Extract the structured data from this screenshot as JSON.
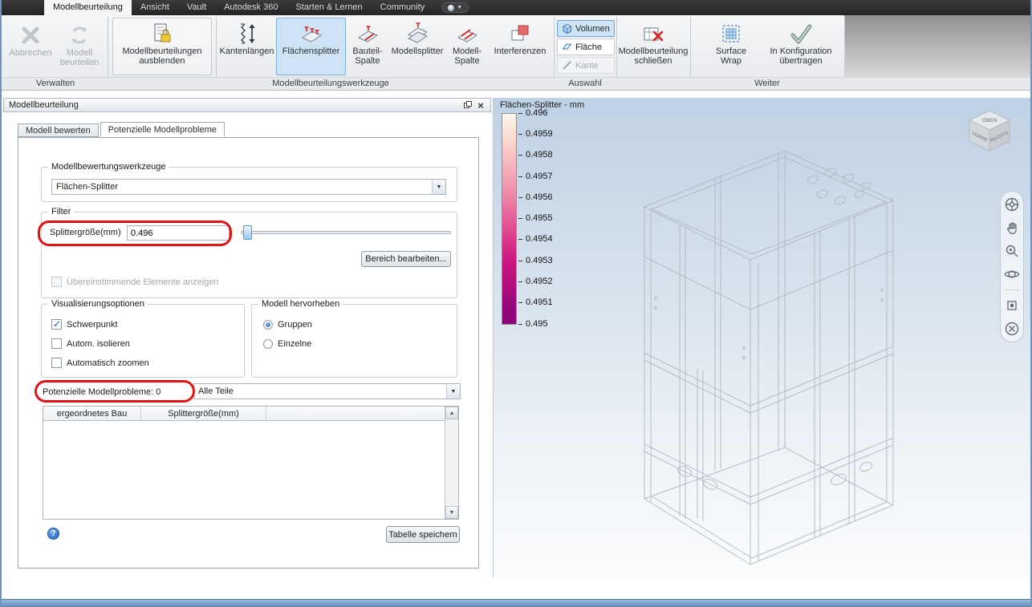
{
  "menubar": {
    "tabs": [
      "Modellbeurteilung",
      "Ansicht",
      "Vault",
      "Autodesk 360",
      "Starten & Lernen",
      "Community"
    ]
  },
  "ribbon": {
    "group_labels": {
      "verwalten": "Verwalten",
      "werkzeuge": "Modellbeurteilungswerkzeuge",
      "auswahl": "Auswahl",
      "weiter": "Weiter"
    },
    "buttons": {
      "abbrechen": "Abbrechen",
      "modell_beurteilen": "Modell beurteilen",
      "ausblenden": "Modellbeurteilungen ausblenden",
      "kantenlaengen": "Kantenlängen",
      "flaechensplitter": "Flächensplitter",
      "bauteil_spalte": "Bauteil-Spalte",
      "modellsplitter": "Modellsplitter",
      "modell_spalte": "Modell-Spalte",
      "interferenzen": "Interferenzen",
      "volumen": "Volumen",
      "flaeche": "Fläche",
      "kante": "Kante",
      "schliessen": "Modellbeurteilung schließen",
      "surface_wrap": "Surface Wrap",
      "konfiguration": "In Konfiguration übertragen"
    }
  },
  "panel": {
    "title": "Modellbeurteilung",
    "tabs": [
      "Modell bewerten",
      "Potenzielle Modellprobleme"
    ],
    "group_labels": {
      "werkzeuge": "Modellbewertungswerkzeuge",
      "filter": "Filter",
      "visualisierung": "Visualisierungsoptionen",
      "hervorheben": "Modell hervorheben"
    },
    "werkzeuge_selected": "Flächen-Splitter",
    "splitter_label": "Splittergröße(mm)",
    "splitter_value": "0.496",
    "bereich_button": "Bereich bearbeiten...",
    "uebereinstimmend_checkbox": "Übereinstimmende Elemente anzeigen",
    "checkboxes": [
      {
        "label": "Schwerpunkt",
        "checked": true
      },
      {
        "label": "Autom. isolieren",
        "checked": false
      },
      {
        "label": "Automatisch zoomen",
        "checked": false
      }
    ],
    "radios": [
      {
        "label": "Gruppen",
        "selected": true
      },
      {
        "label": "Einzelne",
        "selected": false
      }
    ],
    "probleme_label": "Potenzielle Modellprobleme: 0",
    "teile_selected": "Alle Teile",
    "table_columns": [
      "ergeordnetes Bau",
      "Splittergröße(mm)"
    ],
    "save_button": "Tabelle speichern"
  },
  "viewport": {
    "legend_title": "Flächen-Splitter - mm",
    "legend_ticks": [
      "0.496",
      "0.4959",
      "0.4958",
      "0.4957",
      "0.4956",
      "0.4955",
      "0.4954",
      "0.4953",
      "0.4952",
      "0.4951",
      "0.495"
    ],
    "legend_color_top": "#fdf6ec",
    "legend_color_bottom": "#8a0578",
    "viewcube": {
      "top": "OBEN",
      "front": "VORNE",
      "right": "RECHTS"
    }
  }
}
